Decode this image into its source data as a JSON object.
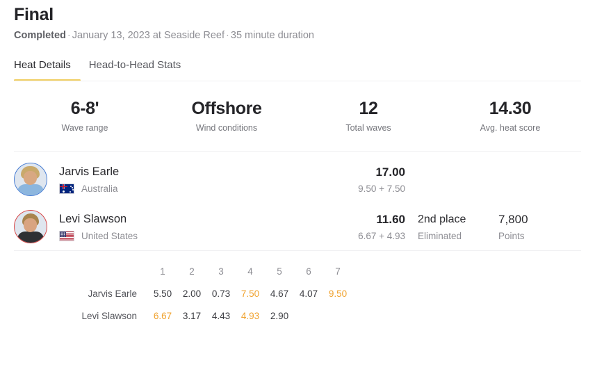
{
  "header": {
    "title": "Final",
    "status": "Completed",
    "separator": "·",
    "date": "January 13, 2023 at Seaside Reef",
    "duration": "35 minute duration"
  },
  "tabs": [
    {
      "label": "Heat Details",
      "active": true
    },
    {
      "label": "Head-to-Head Stats",
      "active": false
    }
  ],
  "stats": [
    {
      "value": "6-8'",
      "label": "Wave range"
    },
    {
      "value": "Offshore",
      "label": "Wind conditions"
    },
    {
      "value": "12",
      "label": "Total waves"
    },
    {
      "value": "14.30",
      "label": "Avg. heat score"
    }
  ],
  "athletes": [
    {
      "name": "Jarvis Earle",
      "country": "Australia",
      "flag": "flag-australia-icon",
      "avatar": "avatar-jarvis-earle",
      "ring_color": "#4a7fd4",
      "score": "17.00",
      "score_breakdown": "9.50 + 7.50",
      "place": "",
      "status": "",
      "points": "",
      "points_label": ""
    },
    {
      "name": "Levi Slawson",
      "country": "United States",
      "flag": "flag-united-states-icon",
      "avatar": "avatar-levi-slawson",
      "ring_color": "#d94a4a",
      "score": "11.60",
      "score_breakdown": "6.67 + 4.93",
      "place": "2nd place",
      "status": "Eliminated",
      "points": "7,800",
      "points_label": "Points"
    }
  ],
  "wave_table": {
    "columns": [
      "1",
      "2",
      "3",
      "4",
      "5",
      "6",
      "7"
    ],
    "rows": [
      {
        "label": "Jarvis Earle",
        "scores": [
          {
            "value": "5.50",
            "counted": false
          },
          {
            "value": "2.00",
            "counted": false
          },
          {
            "value": "0.73",
            "counted": false
          },
          {
            "value": "7.50",
            "counted": true
          },
          {
            "value": "4.67",
            "counted": false
          },
          {
            "value": "4.07",
            "counted": false
          },
          {
            "value": "9.50",
            "counted": true
          }
        ]
      },
      {
        "label": "Levi Slawson",
        "scores": [
          {
            "value": "6.67",
            "counted": true
          },
          {
            "value": "3.17",
            "counted": false
          },
          {
            "value": "4.43",
            "counted": false
          },
          {
            "value": "4.93",
            "counted": true
          },
          {
            "value": "2.90",
            "counted": false
          },
          {
            "value": "",
            "counted": false
          },
          {
            "value": "",
            "counted": false
          }
        ]
      }
    ]
  },
  "colors": {
    "accent_underline": "#f1cf63",
    "counted_score": "#f0a22e",
    "text_primary": "#2b2b2f",
    "text_muted": "#8d8d93",
    "divider": "#f0f0f2"
  }
}
